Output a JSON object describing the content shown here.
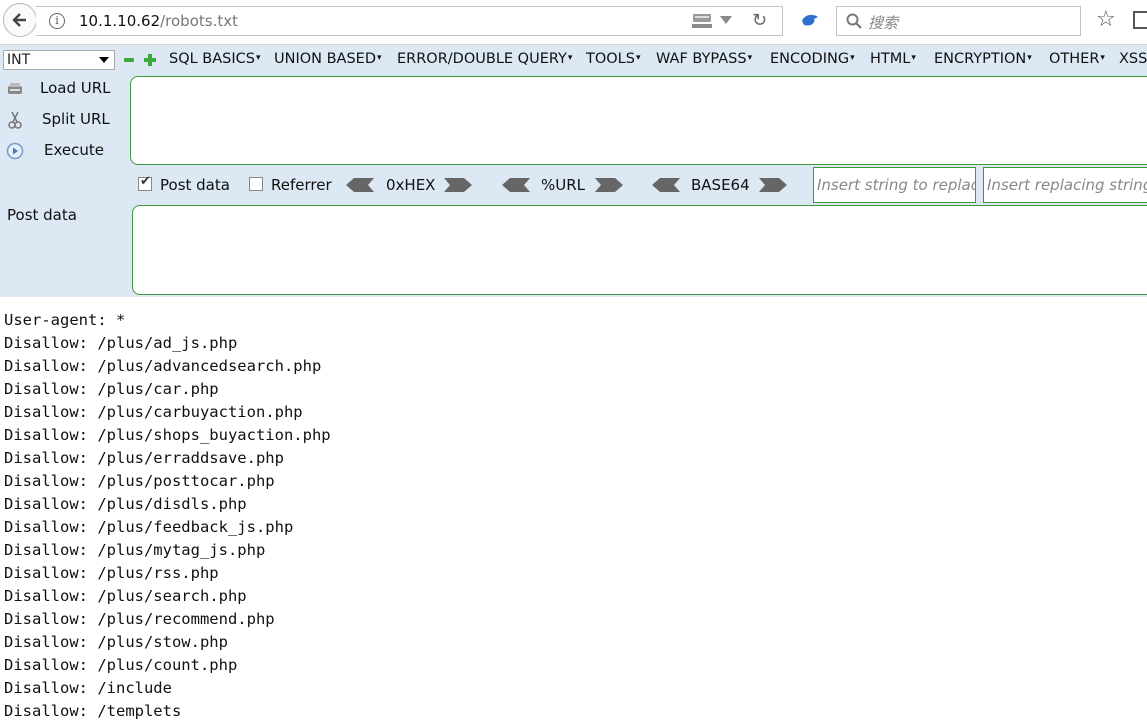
{
  "browser": {
    "url_host": "10.1.10.62",
    "url_path": "/robots.txt",
    "search_placeholder": "搜索"
  },
  "hackbar": {
    "select_value": "INT",
    "menus": [
      "SQL BASICS",
      "UNION BASED",
      "ERROR/DOUBLE QUERY",
      "TOOLS",
      "WAF BYPASS",
      "ENCODING",
      "HTML",
      "ENCRYPTION",
      "OTHER",
      "XSS"
    ],
    "load_url": "Load URL",
    "split_url": "Split URL",
    "execute": "Execute",
    "post_data_checkbox": "Post data",
    "post_data_checked": true,
    "referrer_checkbox": "Referrer",
    "referrer_checked": false,
    "hex_label": "0xHEX",
    "url_label": "%URL",
    "base64_label": "BASE64",
    "replace_placeholder": "Insert string to replace",
    "replacing_placeholder": "Insert replacing string",
    "post_data_label": "Post data"
  },
  "content": {
    "lines": [
      "User-agent: *",
      "Disallow: /plus/ad_js.php",
      "Disallow: /plus/advancedsearch.php",
      "Disallow: /plus/car.php",
      "Disallow: /plus/carbuyaction.php",
      "Disallow: /plus/shops_buyaction.php",
      "Disallow: /plus/erraddsave.php",
      "Disallow: /plus/posttocar.php",
      "Disallow: /plus/disdls.php",
      "Disallow: /plus/feedback_js.php",
      "Disallow: /plus/mytag_js.php",
      "Disallow: /plus/rss.php",
      "Disallow: /plus/search.php",
      "Disallow: /plus/recommend.php",
      "Disallow: /plus/stow.php",
      "Disallow: /plus/count.php",
      "Disallow: /include",
      "Disallow: /templets"
    ]
  }
}
